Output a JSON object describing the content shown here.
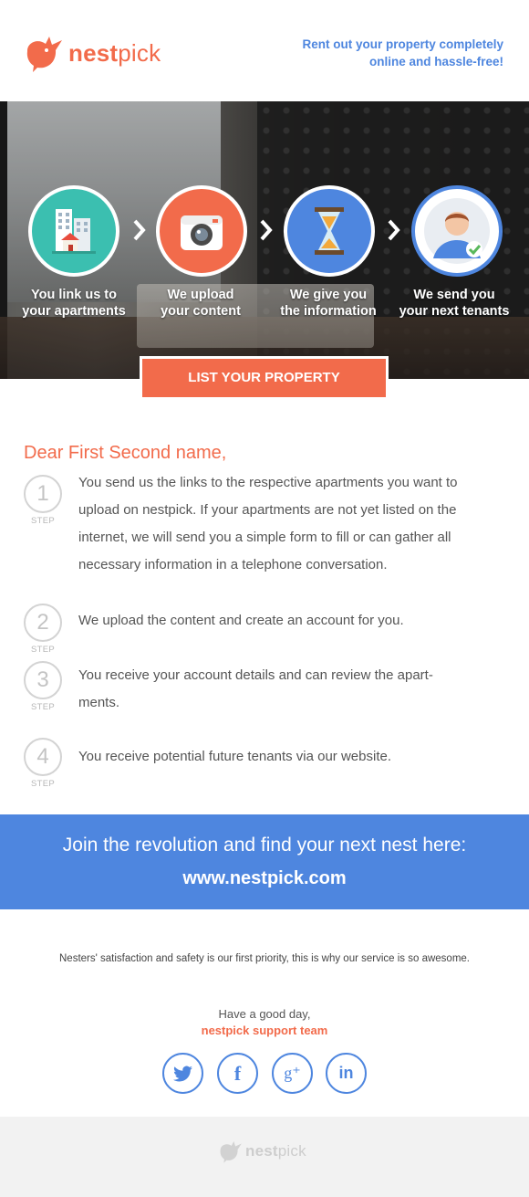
{
  "header": {
    "logo_bold": "nest",
    "logo_light": "pick",
    "tagline_line1": "Rent out your property completely",
    "tagline_line2": "online and hassle-free!"
  },
  "hero": {
    "steps": [
      {
        "line1": "You link us to",
        "line2": "your apartments",
        "icon": "building-icon",
        "color": "#3bbfb0"
      },
      {
        "line1": "We upload",
        "line2": "your content",
        "icon": "camera-icon",
        "color": "#f26b4b"
      },
      {
        "line1": "We give you",
        "line2": "the information",
        "icon": "hourglass-icon",
        "color": "#4e86df"
      },
      {
        "line1": "We send you",
        "line2": "your next tenants",
        "icon": "tenant-avatar-icon",
        "color": "#ffffff"
      }
    ]
  },
  "cta": {
    "label": "LIST YOUR PROPERTY"
  },
  "body": {
    "greeting": "Dear First Second name,",
    "step_label": "STEP",
    "steps": [
      {
        "number": "1",
        "lines": [
          "You send us the links to the respective apartments you want to",
          "upload on nestpick. If your apartments are not yet listed on the",
          "internet, we will send you a simple form to fill or can gather all",
          "necessary information in a telephone conversation."
        ]
      },
      {
        "number": "2",
        "lines": [
          "We upload the content and create an account for you."
        ]
      },
      {
        "number": "3",
        "lines": [
          "You receive your account details and can review the apart-",
          "ments."
        ]
      },
      {
        "number": "4",
        "lines": [
          "You receive potential future tenants via our website."
        ]
      }
    ]
  },
  "banner": {
    "line": "Join the revolution and find your next nest here:",
    "url": "www.nestpick.com"
  },
  "footer": {
    "note": "Nesters' satisfaction and safety is our first priority, this is why our service is so awesome.",
    "signoff": "Have a good day,",
    "team": "nestpick support team",
    "social": [
      {
        "name": "twitter-icon",
        "glyph": "🐦"
      },
      {
        "name": "facebook-icon",
        "glyph": "f"
      },
      {
        "name": "google-plus-icon",
        "glyph": "g⁺"
      },
      {
        "name": "linkedin-icon",
        "glyph": "in"
      }
    ],
    "bottom_logo_bold": "nest",
    "bottom_logo_light": "pick"
  },
  "colors": {
    "brand_orange": "#f26b4b",
    "brand_blue": "#4e86df",
    "teal": "#3bbfb0"
  }
}
